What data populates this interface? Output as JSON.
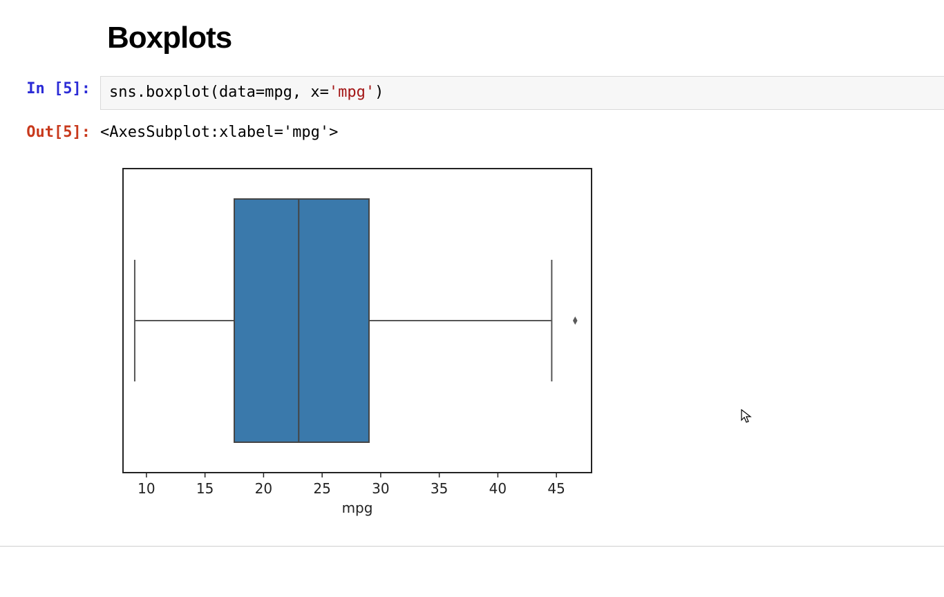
{
  "heading": "Boxplots",
  "cell": {
    "in_prompt": "In [5]:",
    "out_prompt": "Out[5]:",
    "code_prefix": "sns.boxplot(data=mpg, x=",
    "code_string": "'mpg'",
    "code_suffix": ")",
    "output_repr": "<AxesSubplot:xlabel='mpg'>"
  },
  "chart_data": {
    "type": "boxplot",
    "xlabel": "mpg",
    "x_ticks": [
      10,
      15,
      20,
      25,
      30,
      35,
      40,
      45
    ],
    "xlim": [
      8,
      48
    ],
    "series": [
      {
        "name": "mpg",
        "whisker_low": 9,
        "q1": 17.5,
        "median": 23,
        "q3": 29,
        "whisker_high": 44.6,
        "outliers": [
          46.6
        ]
      }
    ],
    "box_color": "#3a79ab"
  }
}
